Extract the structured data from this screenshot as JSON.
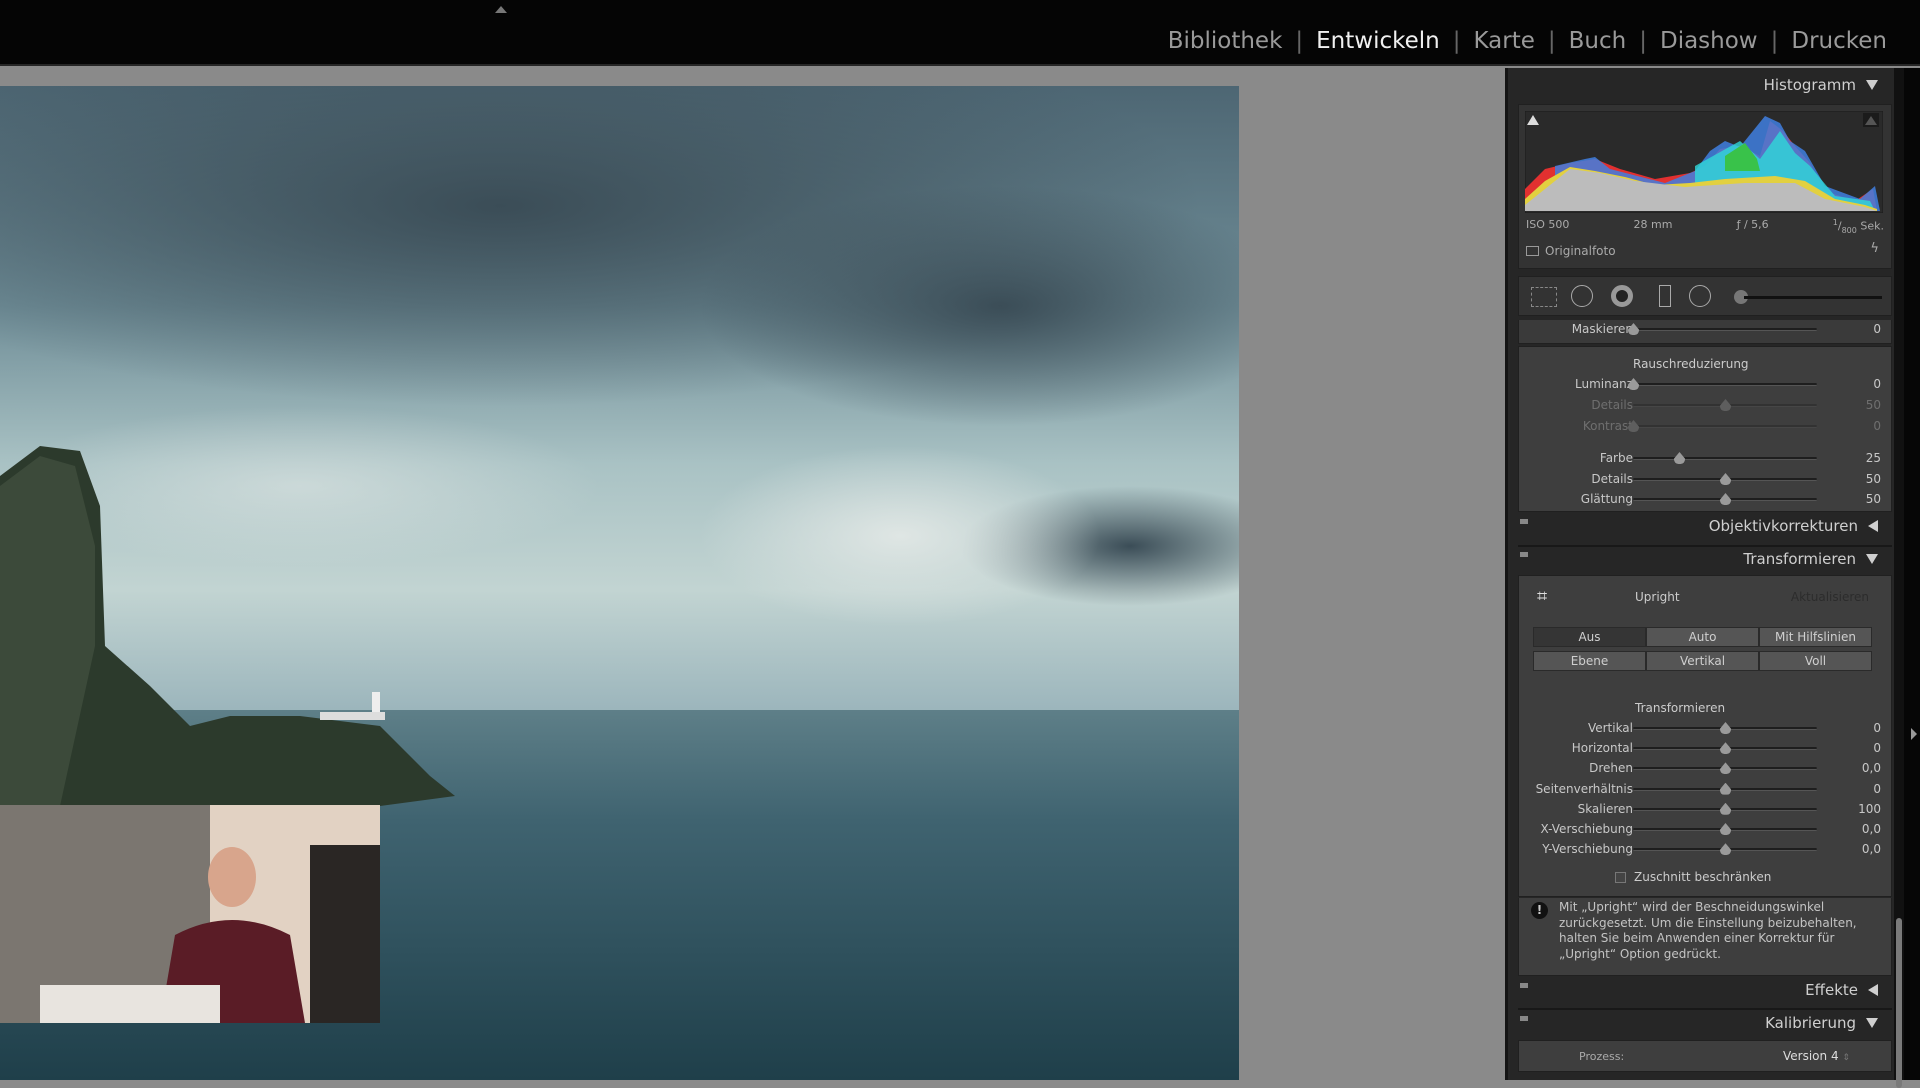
{
  "modules": [
    {
      "label": "Bibliothek",
      "active": false
    },
    {
      "label": "Entwickeln",
      "active": true
    },
    {
      "label": "Karte",
      "active": false
    },
    {
      "label": "Buch",
      "active": false
    },
    {
      "label": "Diashow",
      "active": false
    },
    {
      "label": "Drucken",
      "active": false
    }
  ],
  "histogram": {
    "title": "Histogramm",
    "iso": "ISO 500",
    "focal": "28 mm",
    "aperture": "ƒ / 5,6",
    "shutter_num": "1",
    "shutter_den": "800",
    "shutter_unit": "Sek.",
    "original_label": "Originalfoto",
    "original_checked": false
  },
  "tools": [
    "crop-overlay",
    "spot-removal",
    "red-eye",
    "graduated-filter",
    "radial-filter",
    "adjustment-brush"
  ],
  "detail": {
    "masking": {
      "label": "Maskieren",
      "value": "0",
      "min": 0,
      "max": 100
    },
    "noise_title": "Rauschreduzierung",
    "sliders": [
      {
        "label": "Luminanz",
        "value": "0",
        "num": 0,
        "min": 0,
        "max": 100,
        "dim": false
      },
      {
        "label": "Details",
        "value": "50",
        "num": 50,
        "min": 0,
        "max": 100,
        "dim": true
      },
      {
        "label": "Kontrast",
        "value": "0",
        "num": 0,
        "min": 0,
        "max": 100,
        "dim": true
      },
      {
        "label": "Farbe",
        "value": "25",
        "num": 25,
        "min": 0,
        "max": 100,
        "dim": false
      },
      {
        "label": "Details",
        "value": "50",
        "num": 50,
        "min": 0,
        "max": 100,
        "dim": false
      },
      {
        "label": "Glättung",
        "value": "50",
        "num": 50,
        "min": 0,
        "max": 100,
        "dim": false
      }
    ]
  },
  "lens": {
    "title": "Objektivkorrekturen",
    "expanded": false
  },
  "transform": {
    "title": "Transformieren",
    "expanded": true,
    "upright_label": "Upright",
    "update_label": "Aktualisieren",
    "buttons": [
      {
        "label": "Aus",
        "selected": true
      },
      {
        "label": "Auto",
        "selected": false
      },
      {
        "label": "Mit Hilfslinien",
        "selected": false
      },
      {
        "label": "Ebene",
        "selected": false
      },
      {
        "label": "Vertikal",
        "selected": false
      },
      {
        "label": "Voll",
        "selected": false
      }
    ],
    "sub_title": "Transformieren",
    "sliders": [
      {
        "label": "Vertikal",
        "value": "0",
        "num": 0,
        "min": -100,
        "max": 100
      },
      {
        "label": "Horizontal",
        "value": "0",
        "num": 0,
        "min": -100,
        "max": 100
      },
      {
        "label": "Drehen",
        "value": "0,0",
        "num": 0,
        "min": -10,
        "max": 10
      },
      {
        "label": "Seitenverhältnis",
        "value": "0",
        "num": 0,
        "min": -100,
        "max": 100
      },
      {
        "label": "Skalieren",
        "value": "100",
        "num": 100,
        "min": 50,
        "max": 150
      },
      {
        "label": "X-Verschiebung",
        "value": "0,0",
        "num": 0,
        "min": -100,
        "max": 100
      },
      {
        "label": "Y-Verschiebung",
        "value": "0,0",
        "num": 0,
        "min": -100,
        "max": 100
      }
    ],
    "constrain_label": "Zuschnitt beschränken",
    "constrain_checked": false,
    "info_text": "Mit „Upright“ wird der Beschneidungswinkel zurückgesetzt. Um die Einstellung beizubehalten, halten Sie beim Anwenden einer Korrektur für „Upright“ Option gedrückt."
  },
  "effects": {
    "title": "Effekte",
    "expanded": false
  },
  "calibration": {
    "title": "Kalibrierung",
    "expanded": true,
    "process_label": "Prozess:",
    "process_value": "Version 4"
  }
}
